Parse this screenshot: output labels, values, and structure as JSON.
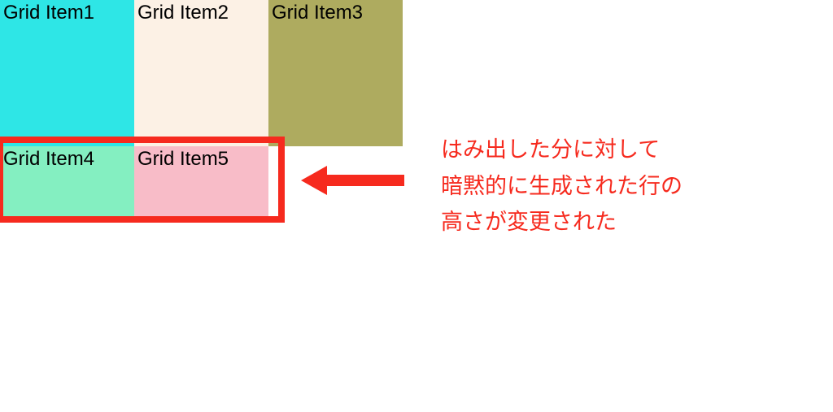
{
  "grid": {
    "row1": {
      "cell1": {
        "label": "Grid Item1",
        "color": "#2ee6e6"
      },
      "cell2": {
        "label": "Grid Item2",
        "color": "#fcf1e5"
      },
      "cell3": {
        "label": "Grid Item3",
        "color": "#aeab5f"
      }
    },
    "row2": {
      "cell4": {
        "label": "Grid Item4",
        "color": "#84efc1"
      },
      "cell5": {
        "label": "Grid Item5",
        "color": "#f8bcc8"
      }
    }
  },
  "annotation": {
    "line1": "はみ出した分に対して",
    "line2": "暗黙的に生成された行の",
    "line3": "高さが変更された"
  },
  "colors": {
    "highlight": "#f62a1e",
    "arrow": "#f62a1e",
    "annotationText": "#f62a1e"
  }
}
